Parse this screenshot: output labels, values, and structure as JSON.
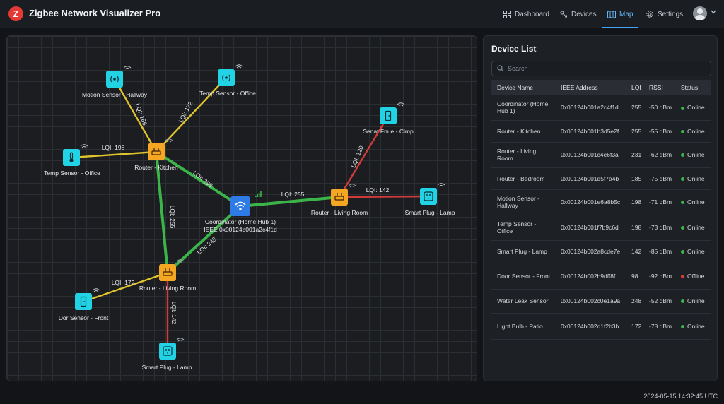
{
  "app": {
    "logo_letter": "Z",
    "title": "Zigbee Network Visualizer Pro"
  },
  "nav": [
    {
      "label": "Dashboard",
      "icon": "dashboard-icon"
    },
    {
      "label": "Devices",
      "icon": "devices-icon"
    },
    {
      "label": "Map",
      "icon": "map-icon",
      "active": true
    },
    {
      "label": "Settings",
      "icon": "gear-icon"
    }
  ],
  "map": {
    "nodes": [
      {
        "id": "coord",
        "type": "coordinator",
        "icon": "wifi-icon",
        "label": [
          "Coordinator (Home Hub 1)",
          "IEEE 0x00124b001a2c4f1d"
        ]
      },
      {
        "id": "rk",
        "type": "router",
        "icon": "router-icon",
        "label": [
          "Router - Kitchen"
        ]
      },
      {
        "id": "rl1",
        "type": "router",
        "icon": "router-icon",
        "label": [
          "Router - Living Room"
        ]
      },
      {
        "id": "rl2",
        "type": "router",
        "icon": "router-icon",
        "label": [
          "Router - Living Room"
        ]
      },
      {
        "id": "motion",
        "type": "end",
        "icon": "motion-sensor-icon",
        "label": [
          "Motion Sensor - Hallway"
        ]
      },
      {
        "id": "temp1",
        "type": "end",
        "icon": "motion-sensor-icon",
        "label": [
          "Temp Sensor - Office"
        ]
      },
      {
        "id": "temp2",
        "type": "end",
        "icon": "thermometer-icon",
        "label": [
          "Temp Sensor - Office"
        ]
      },
      {
        "id": "senat",
        "type": "end",
        "icon": "phone-sensor-icon",
        "label": [
          "Senat Fnue - Cimp"
        ]
      },
      {
        "id": "plug1",
        "type": "end",
        "icon": "plug-icon",
        "label": [
          "Smart Plug - Lamp"
        ]
      },
      {
        "id": "door",
        "type": "end",
        "icon": "phone-sensor-icon",
        "label": [
          "Dor Sensor - Front"
        ]
      },
      {
        "id": "plug2",
        "type": "end",
        "icon": "plug-icon",
        "label": [
          "Smart Plug - Lamp"
        ]
      }
    ],
    "links": [
      {
        "from": "coord",
        "to": "rk",
        "label": "LQI: 298",
        "quality": "good"
      },
      {
        "from": "coord",
        "to": "rl1",
        "label": "LQI: 255",
        "quality": "good"
      },
      {
        "from": "coord",
        "to": "rl2",
        "label": "LQI: 248",
        "quality": "good"
      },
      {
        "from": "rk",
        "to": "rl2",
        "label": "LQI: 255",
        "quality": "good"
      },
      {
        "from": "rk",
        "to": "temp2",
        "label": "LQI: 198",
        "quality": "fair"
      },
      {
        "from": "rk",
        "to": "motion",
        "label": "LQI: 185",
        "quality": "fair"
      },
      {
        "from": "rk",
        "to": "temp1",
        "label": "LQI: 172",
        "quality": "fair"
      },
      {
        "from": "rl1",
        "to": "senat",
        "label": "LQI: 120",
        "quality": "poor"
      },
      {
        "from": "rl1",
        "to": "plug1",
        "label": "LQI: 142",
        "quality": "poor"
      },
      {
        "from": "rl2",
        "to": "door",
        "label": "LQI: 172",
        "quality": "fair"
      },
      {
        "from": "rl2",
        "to": "plug2",
        "label": "LQI: 142",
        "quality": "poor"
      }
    ],
    "colors": {
      "good": "#3bb54a",
      "fair": "#e0c42c",
      "poor": "#d33b3b",
      "router": "#f5a623",
      "end": "#22d3e6",
      "coordinator": "#2f7be6"
    }
  },
  "device_list": {
    "title": "Device List",
    "search_placeholder": "Search",
    "columns": [
      "Device Name",
      "IEEE Address",
      "LQI",
      "RSSI",
      "Status"
    ],
    "rows": [
      {
        "name": "Coordinator (Home Hub 1)",
        "ieee": "0x00124b001a2c4f1d",
        "lqi": "255",
        "rssi": "-50 dBm",
        "status": "Online"
      },
      {
        "name": "Router - Kitchen",
        "ieee": "0x00124b001b3d5e2f",
        "lqi": "255",
        "rssi": "-55 dBm",
        "status": "Online"
      },
      {
        "name": "Router - Living Room",
        "ieee": "0x00124b001c4e6f3a",
        "lqi": "231",
        "rssi": "-62 dBm",
        "status": "Online"
      },
      {
        "name": "Router - Bedroom",
        "ieee": "0x00124b001d5f7a4b",
        "lqi": "185",
        "rssi": "-75 dBm",
        "status": "Online"
      },
      {
        "name": "Motion Sensor - Hallway",
        "ieee": "0x00124b001e6a8b5c",
        "lqi": "198",
        "rssi": "-71 dBm",
        "status": "Online"
      },
      {
        "name": "Temp Sensor - Office",
        "ieee": "0x00124b001f7b9c6d",
        "lqi": "198",
        "rssi": "-73 dBm",
        "status": "Online"
      },
      {
        "name": "Smart Plug - Lamp",
        "ieee": "0x00124b002a8cde7e",
        "lqi": "142",
        "rssi": "-85 dBm",
        "status": "Online"
      },
      {
        "name": "Door Sensor - Front",
        "ieee": "0x00124b002b9dff8f",
        "lqi": "98",
        "rssi": "-92 dBm",
        "status": "Offline"
      },
      {
        "name": "Water Leak Sensor",
        "ieee": "0x00124b002c0e1a9a",
        "lqi": "248",
        "rssi": "-52 dBm",
        "status": "Online"
      },
      {
        "name": "Light Bulb - Patio",
        "ieee": "0x00124b002d1f2b3b",
        "lqi": "172",
        "rssi": "-78 dBm",
        "status": "Online"
      }
    ],
    "status_colors": {
      "Online": "#3bb54a",
      "Offline": "#e53935"
    }
  },
  "footer": {
    "timestamp": "2024-05-15 14:32:45 UTC"
  }
}
